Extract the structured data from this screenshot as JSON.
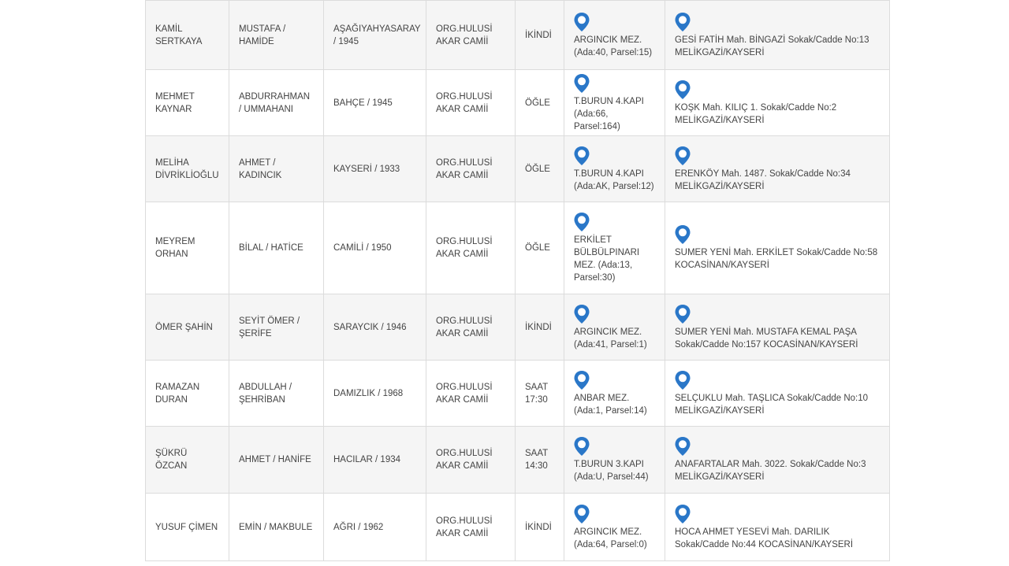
{
  "accent_color": "#2a77c8",
  "icon": "map-pin-icon",
  "rows": [
    {
      "name": "KAMİL SERTKAYA",
      "parents": "MUSTAFA / HAMİDE",
      "birth": "AŞAĞIYAHYASARAY / 1945",
      "mosque": "ORG.HULUSİ AKAR CAMİİ",
      "prayer": "İKİNDİ",
      "cemetery": "ARGINCIK MEZ. (Ada:40, Parsel:15)",
      "address": "GESİ FATİH Mah. BİNGAZİ Sokak/Cadde No:13 MELİKGAZİ/KAYSERİ"
    },
    {
      "name": "MEHMET KAYNAR",
      "parents": "ABDURRAHMAN / UMMAHANI",
      "birth": "BAHÇE / 1945",
      "mosque": "ORG.HULUSİ AKAR CAMİİ",
      "prayer": "ÖĞLE",
      "cemetery": "T.BURUN 4.KAPI (Ada:66, Parsel:164)",
      "address": "KOŞK Mah. KILIÇ 1. Sokak/Cadde No:2 MELİKGAZİ/KAYSERİ"
    },
    {
      "name": "MELİHA DİVRİKLİOĞLU",
      "parents": "AHMET / KADINCIK",
      "birth": "KAYSERİ / 1933",
      "mosque": "ORG.HULUSİ AKAR CAMİİ",
      "prayer": "ÖĞLE",
      "cemetery": "T.BURUN 4.KAPI (Ada:AK, Parsel:12)",
      "address": "ERENKÖY Mah. 1487. Sokak/Cadde No:34 MELİKGAZİ/KAYSERİ"
    },
    {
      "name": "MEYREM ORHAN",
      "parents": "BİLAL / HATİCE",
      "birth": "CAMİLİ / 1950",
      "mosque": "ORG.HULUSİ AKAR CAMİİ",
      "prayer": "ÖĞLE",
      "cemetery": "ERKİLET BÜLBÜLPINARI MEZ. (Ada:13, Parsel:30)",
      "address": "SUMER YENİ Mah. ERKİLET Sokak/Cadde No:58 KOCASİNAN/KAYSERİ"
    },
    {
      "name": "ÖMER ŞAHİN",
      "parents": "SEYİT ÖMER / ŞERİFE",
      "birth": "SARAYCIK / 1946",
      "mosque": "ORG.HULUSİ AKAR CAMİİ",
      "prayer": "İKİNDİ",
      "cemetery": "ARGINCIK MEZ. (Ada:41, Parsel:1)",
      "address": "SUMER YENİ Mah. MUSTAFA KEMAL PAŞA Sokak/Cadde No:157 KOCASİNAN/KAYSERİ"
    },
    {
      "name": "RAMAZAN DURAN",
      "parents": "ABDULLAH / ŞEHRİBAN",
      "birth": "DAMIZLIK / 1968",
      "mosque": "ORG.HULUSİ AKAR CAMİİ",
      "prayer": "SAAT 17:30",
      "cemetery": "ANBAR MEZ. (Ada:1, Parsel:14)",
      "address": "SELÇUKLU Mah. TAŞLICA Sokak/Cadde No:10 MELİKGAZİ/KAYSERİ"
    },
    {
      "name": "ŞÜKRÜ ÖZCAN",
      "parents": "AHMET / HANİFE",
      "birth": "HACILAR / 1934",
      "mosque": "ORG.HULUSİ AKAR CAMİİ",
      "prayer": "SAAT 14:30",
      "cemetery": "T.BURUN 3.KAPI (Ada:U, Parsel:44)",
      "address": "ANAFARTALAR Mah. 3022. Sokak/Cadde No:3 MELİKGAZİ/KAYSERİ"
    },
    {
      "name": "YUSUF ÇİMEN",
      "parents": "EMİN / MAKBULE",
      "birth": "AĞRI / 1962",
      "mosque": "ORG.HULUSİ AKAR CAMİİ",
      "prayer": "İKİNDİ",
      "cemetery": "ARGINCIK MEZ. (Ada:64, Parsel:0)",
      "address": "HOCA AHMET YESEVİ Mah. DARILIK Sokak/Cadde No:44 KOCASİNAN/KAYSERİ"
    }
  ]
}
